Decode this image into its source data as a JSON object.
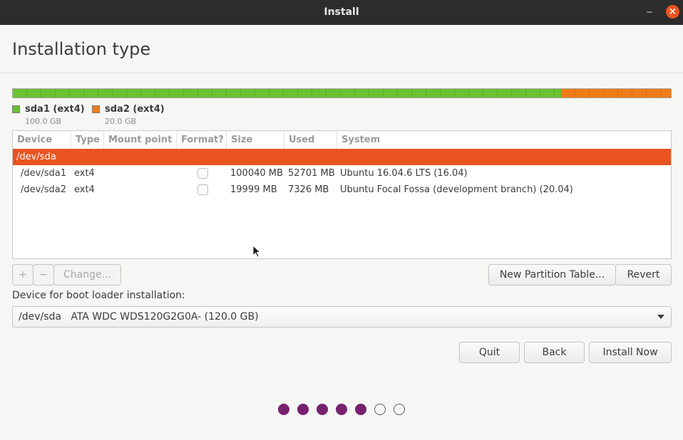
{
  "window": {
    "title": "Install"
  },
  "page": {
    "title": "Installation type"
  },
  "colors": {
    "accent": "#e95420",
    "sda1": "#6ac230",
    "sda2": "#f07c17",
    "progress": "#77216f"
  },
  "partition_bar": [
    {
      "name": "sda1 (ext4)",
      "size": "100.0 GB",
      "color": "#6ac230",
      "size_gb": 100.0
    },
    {
      "name": "sda2 (ext4)",
      "size": "20.0 GB",
      "color": "#f07c17",
      "size_gb": 20.0
    }
  ],
  "table": {
    "headers": [
      "Device",
      "Type",
      "Mount point",
      "Format?",
      "Size",
      "Used",
      "System"
    ],
    "disk": "/dev/sda",
    "rows": [
      {
        "device": "/dev/sda1",
        "type": "ext4",
        "mount": "",
        "format": false,
        "size": "100040 MB",
        "used": "52701 MB",
        "system": "Ubuntu 16.04.6 LTS (16.04)"
      },
      {
        "device": "/dev/sda2",
        "type": "ext4",
        "mount": "",
        "format": false,
        "size": "19999 MB",
        "used": "7326 MB",
        "system": "Ubuntu Focal Fossa (development branch) (20.04)"
      }
    ]
  },
  "toolbar": {
    "add": "+",
    "remove": "−",
    "change": "Change...",
    "new_table": "New Partition Table...",
    "revert": "Revert"
  },
  "bootloader": {
    "label": "Device for boot loader installation:",
    "selected": "/dev/sda   ATA WDC WDS120G2G0A- (120.0 GB)"
  },
  "nav": {
    "quit": "Quit",
    "back": "Back",
    "install": "Install Now"
  },
  "progress": {
    "total_steps": 7,
    "completed_steps": 5
  }
}
